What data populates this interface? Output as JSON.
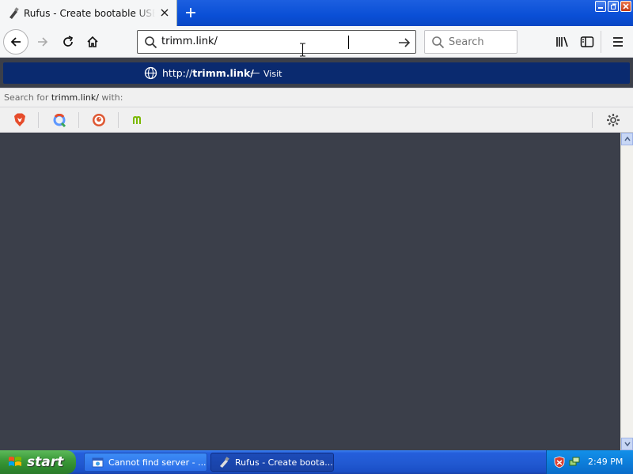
{
  "browser": {
    "tab": {
      "title": "Rufus - Create bootable USB drives the easy way"
    },
    "window_controls": [
      "minimize-icon",
      "restore-icon",
      "close-icon"
    ],
    "url_input": {
      "value": "trimm.link/"
    },
    "search_box": {
      "placeholder": "Search"
    }
  },
  "url_popup": {
    "visit_prefix": "http://",
    "visit_host": "trimm.link/",
    "separator": "—",
    "visit_label": "Visit",
    "search_for_prefix": "Search for",
    "search_for_query": "trimm.link/",
    "search_for_suffix": "with:",
    "engines": [
      {
        "name": "brave-icon",
        "color": "#e64c2b"
      },
      {
        "name": "qwant-icon",
        "color": "#5c97ff"
      },
      {
        "name": "duckduckgo-icon",
        "color": "#de5833"
      },
      {
        "name": "mojeek-icon",
        "color": "#7ab800"
      }
    ]
  },
  "taskbar": {
    "start_label": "start",
    "tasks": [
      {
        "label": "Cannot find server - ..."
      },
      {
        "label": "Rufus - Create boota..."
      }
    ],
    "clock": "2:49 PM"
  },
  "colors": {
    "popup_highlight": "#0a2a6f",
    "content_bg": "#3b3f4a",
    "taskbar_blue": "#245edb",
    "start_green": "#3c9a3a"
  }
}
